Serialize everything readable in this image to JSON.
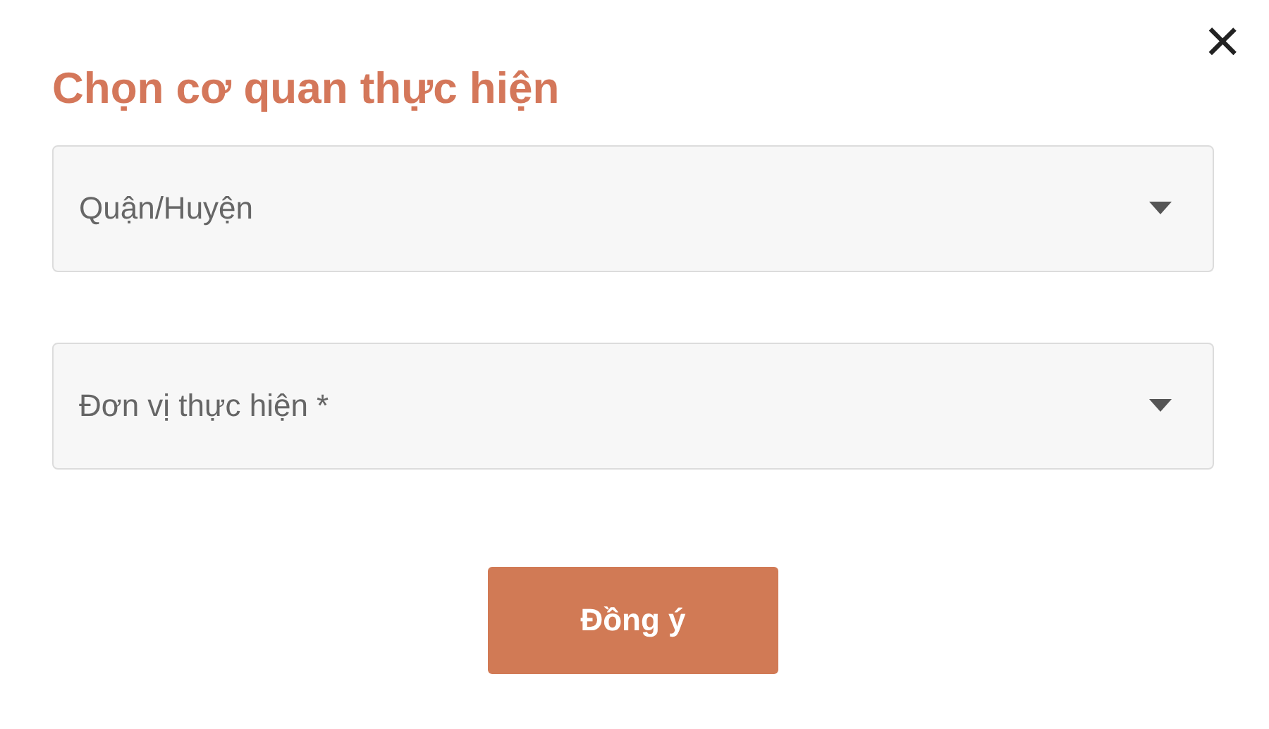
{
  "dialog": {
    "title": "Chọn cơ quan thực hiện",
    "close": "×"
  },
  "fields": [
    {
      "placeholder": "Quận/Huyện"
    },
    {
      "placeholder": "Đơn vị thực hiện *"
    }
  ],
  "button": "Đồng ý"
}
